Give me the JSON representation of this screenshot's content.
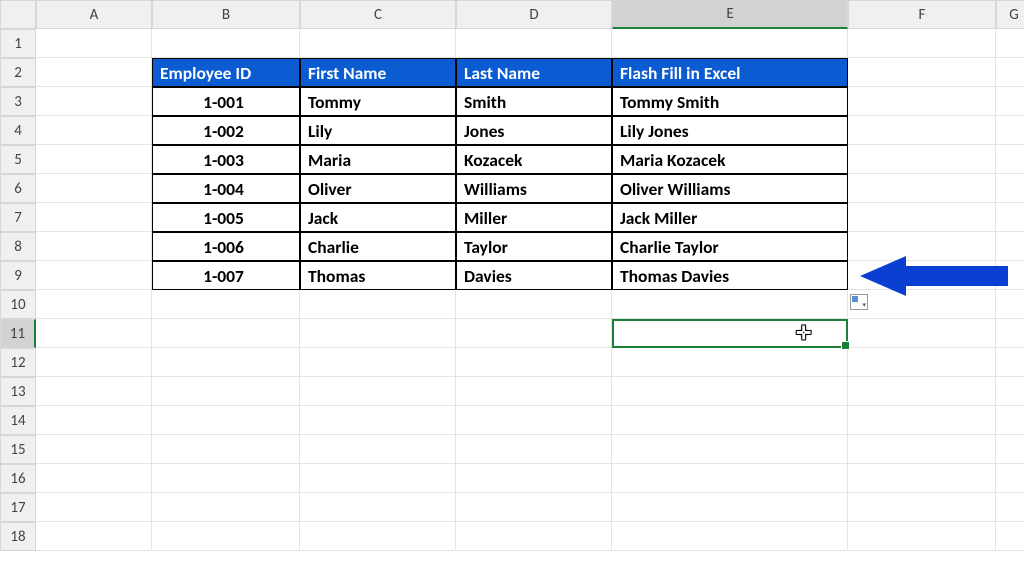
{
  "columns": [
    "A",
    "B",
    "C",
    "D",
    "E",
    "F",
    "G"
  ],
  "rows": [
    1,
    2,
    3,
    4,
    5,
    6,
    7,
    8,
    9,
    10,
    11,
    12,
    13,
    14,
    15,
    16,
    17,
    18
  ],
  "highlight_col_index": 4,
  "highlight_row_index": 10,
  "table": {
    "headers": [
      "Employee ID",
      "First Name",
      "Last Name",
      "Flash Fill in Excel"
    ],
    "center_cols": [
      0
    ],
    "rows": [
      [
        "1-001",
        "Tommy",
        "Smith",
        "Tommy Smith"
      ],
      [
        "1-002",
        "Lily",
        "Jones",
        "Lily Jones"
      ],
      [
        "1-003",
        "Maria",
        "Kozacek",
        "Maria Kozacek"
      ],
      [
        "1-004",
        "Oliver",
        "Williams",
        "Oliver Williams"
      ],
      [
        "1-005",
        "Jack",
        "Miller",
        "Jack Miller"
      ],
      [
        "1-006",
        "Charlie",
        "Taylor",
        "Charlie Taylor"
      ],
      [
        "1-007",
        "Thomas",
        "Davies",
        "Thomas Davies"
      ]
    ]
  },
  "active_cell": "E11",
  "arrow_color": "#0a3fd1",
  "cursor_glyph": "✛"
}
